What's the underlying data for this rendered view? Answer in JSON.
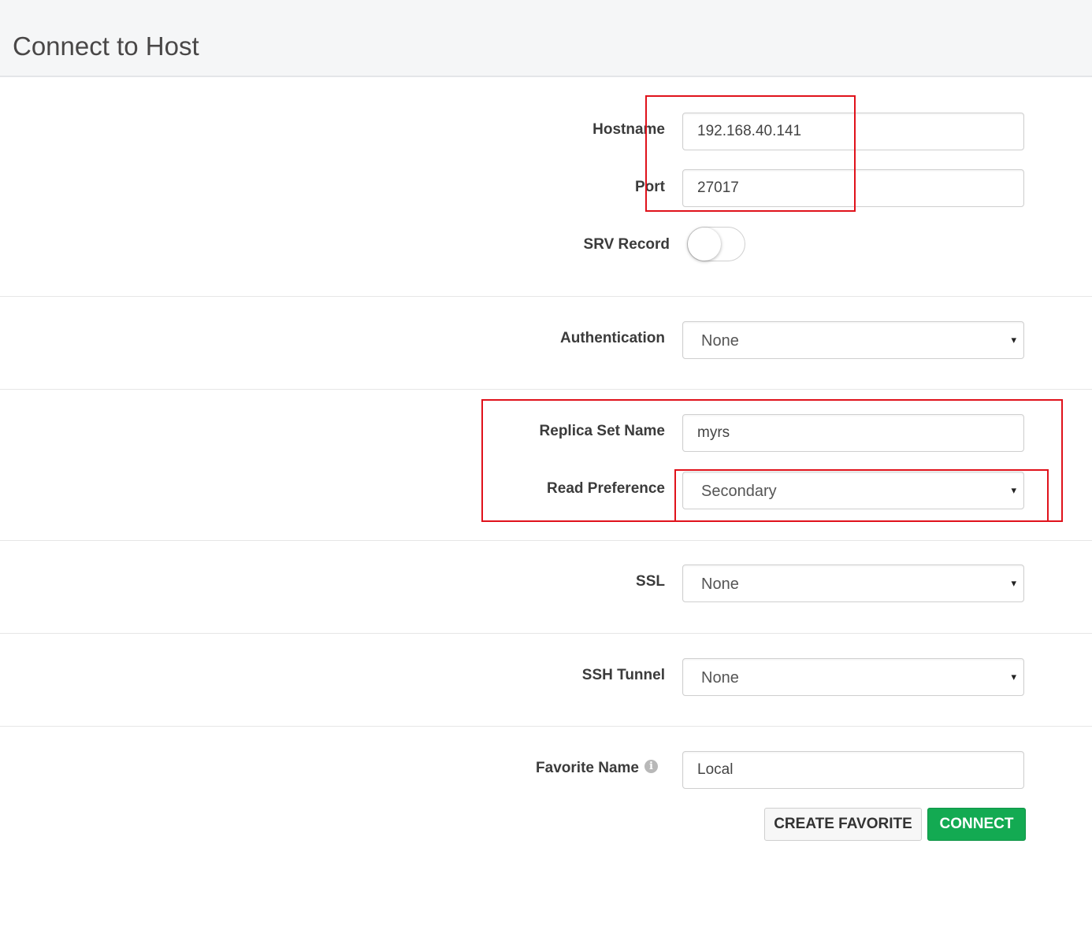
{
  "header": {
    "title": "Connect to Host"
  },
  "form": {
    "hostname": {
      "label": "Hostname",
      "value": "192.168.40.141"
    },
    "port": {
      "label": "Port",
      "value": "27017"
    },
    "srv_record": {
      "label": "SRV Record",
      "enabled": false
    },
    "authentication": {
      "label": "Authentication",
      "selected": "None"
    },
    "replica_set_name": {
      "label": "Replica Set Name",
      "value": "myrs"
    },
    "read_preference": {
      "label": "Read Preference",
      "selected": "Secondary"
    },
    "ssl": {
      "label": "SSL",
      "selected": "None"
    },
    "ssh_tunnel": {
      "label": "SSH Tunnel",
      "selected": "None"
    },
    "favorite_name": {
      "label": "Favorite Name",
      "value": "Local",
      "info_icon": "info-icon"
    }
  },
  "buttons": {
    "create_favorite": "CREATE FAVORITE",
    "connect": "CONNECT"
  },
  "colors": {
    "connect_green": "#13aa52",
    "annotation_red": "#e0121b",
    "header_bg": "#f5f6f7"
  },
  "icons": {
    "select_caret": "▾",
    "info": "i"
  }
}
